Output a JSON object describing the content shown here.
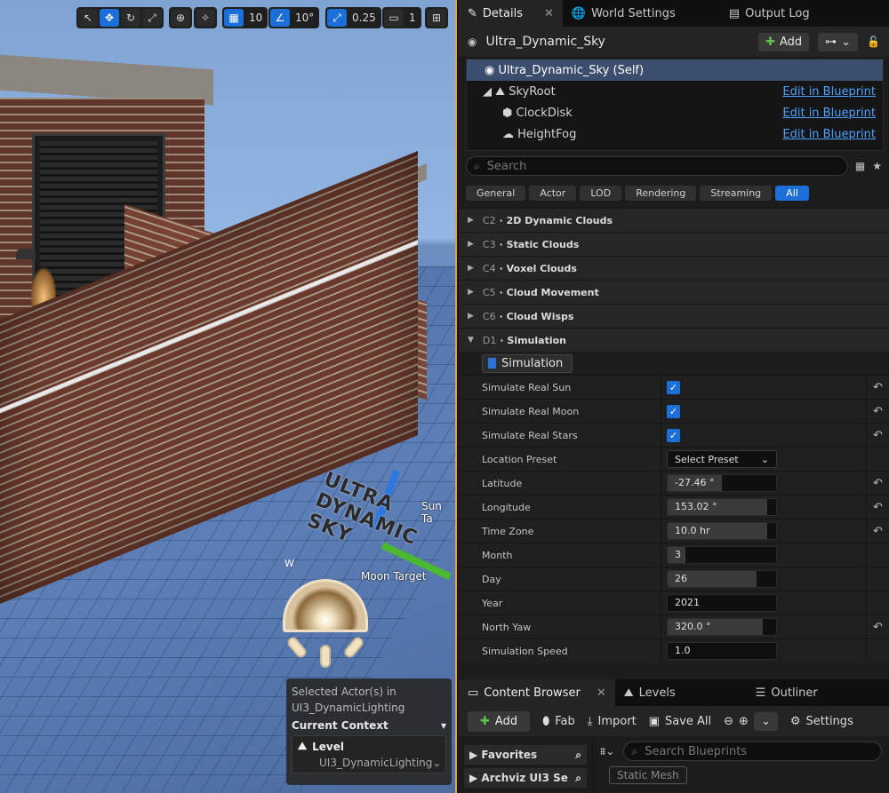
{
  "viewport": {
    "toolbar": {
      "grid_snap": "10",
      "angle_snap": "10°",
      "scale_snap": "0.25",
      "camera_speed": "1"
    },
    "labels": {
      "sun_target": "Sun Ta",
      "moon_target": "Moon Target",
      "logo": "ULTRA DYNAMIC SKY",
      "compass_w": "W"
    },
    "context": {
      "title": "Selected Actor(s) in UI3_DynamicLighting",
      "heading": "Current Context",
      "level_label": "Level",
      "level_value": "UI3_DynamicLighting"
    }
  },
  "details": {
    "tabs": [
      {
        "label": "Details",
        "icon": "pencil-icon"
      },
      {
        "label": "World Settings",
        "icon": "globe-icon"
      },
      {
        "label": "Output Log",
        "icon": "log-icon"
      }
    ],
    "actor_name": "Ultra_Dynamic_Sky",
    "add_label": "Add",
    "components": [
      {
        "label": "Ultra_Dynamic_Sky (Self)",
        "link": ""
      },
      {
        "label": "SkyRoot",
        "link": "Edit in Blueprint"
      },
      {
        "label": "ClockDisk",
        "link": "Edit in Blueprint"
      },
      {
        "label": "HeightFog",
        "link": "Edit in Blueprint"
      }
    ],
    "search_placeholder": "Search",
    "filters": [
      "General",
      "Actor",
      "LOD",
      "Rendering",
      "Streaming",
      "All"
    ],
    "categories": [
      {
        "code": "C2",
        "label": "2D Dynamic Clouds"
      },
      {
        "code": "C3",
        "label": "Static Clouds"
      },
      {
        "code": "C4",
        "label": "Voxel Clouds"
      },
      {
        "code": "C5",
        "label": "Cloud Movement"
      },
      {
        "code": "C6",
        "label": "Cloud Wisps"
      },
      {
        "code": "D1",
        "label": "Simulation"
      }
    ],
    "section_badge": "Simulation",
    "properties": [
      {
        "label": "Simulate Real Sun",
        "type": "check",
        "value": "✓"
      },
      {
        "label": "Simulate Real Moon",
        "type": "check",
        "value": "✓"
      },
      {
        "label": "Simulate Real Stars",
        "type": "check",
        "value": "✓"
      },
      {
        "label": "Location Preset",
        "type": "select",
        "value": "Select Preset"
      },
      {
        "label": "Latitude",
        "type": "num",
        "value": "-27.46 °",
        "fill": 0.5
      },
      {
        "label": "Longitude",
        "type": "num",
        "value": "153.02 °",
        "fill": 0.92
      },
      {
        "label": "Time Zone",
        "type": "num",
        "value": "10.0 hr",
        "fill": 0.92
      },
      {
        "label": "Month",
        "type": "num",
        "value": "3",
        "fill": 0.16
      },
      {
        "label": "Day",
        "type": "num",
        "value": "26",
        "fill": 0.82
      },
      {
        "label": "Year",
        "type": "num",
        "value": "2021",
        "fill": 0
      },
      {
        "label": "North Yaw",
        "type": "num",
        "value": "320.0 °",
        "fill": 0.88
      },
      {
        "label": "Simulation Speed",
        "type": "num",
        "value": "1.0",
        "fill": 0
      }
    ]
  },
  "content_browser": {
    "tabs": [
      {
        "label": "Content Browser",
        "icon": "folder-icon"
      },
      {
        "label": "Levels",
        "icon": "levels-icon"
      },
      {
        "label": "Outliner",
        "icon": "list-icon"
      }
    ],
    "toolbar": {
      "add": "Add",
      "fab": "Fab",
      "import": "Import",
      "save_all": "Save All",
      "settings": "Settings"
    },
    "favorites": "Favorites",
    "collection": "Archviz UI3 Se",
    "search_placeholder": "Search Blueprints",
    "filter_chip": "Static Mesh"
  }
}
